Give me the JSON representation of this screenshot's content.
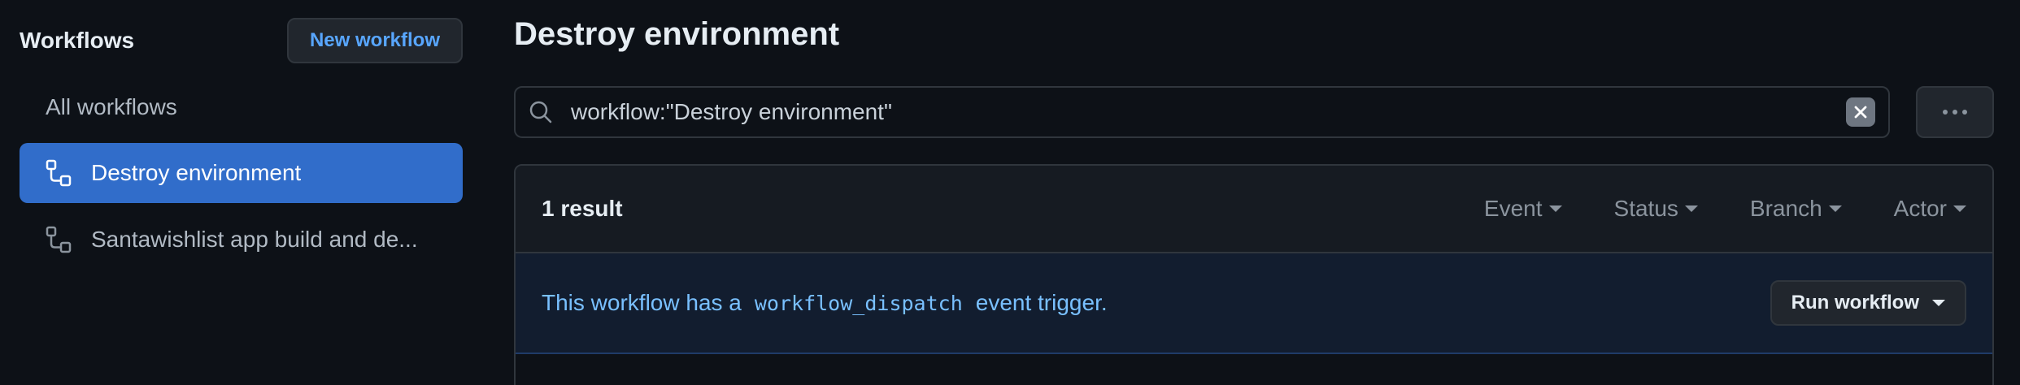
{
  "sidebar": {
    "title": "Workflows",
    "new_button": "New workflow",
    "all_label": "All workflows",
    "items": [
      {
        "label": "Destroy environment",
        "active": true
      },
      {
        "label": "Santawishlist app build and de...",
        "active": false
      }
    ]
  },
  "main": {
    "title": "Destroy environment",
    "search": {
      "value": "workflow:\"Destroy environment\""
    },
    "results": {
      "count_label": "1 result",
      "filters": [
        "Event",
        "Status",
        "Branch",
        "Actor"
      ]
    },
    "banner": {
      "prefix": "This workflow has a",
      "code": "workflow_dispatch",
      "suffix": "event trigger.",
      "run_button": "Run workflow"
    }
  },
  "colors": {
    "background": "#0d1117",
    "accent": "#316dca",
    "link": "#58a6ff",
    "banner_text": "#79c0ff"
  },
  "icons": [
    "workflow-icon",
    "search-icon",
    "clear-icon",
    "kebab-icon",
    "caret-down-icon"
  ]
}
